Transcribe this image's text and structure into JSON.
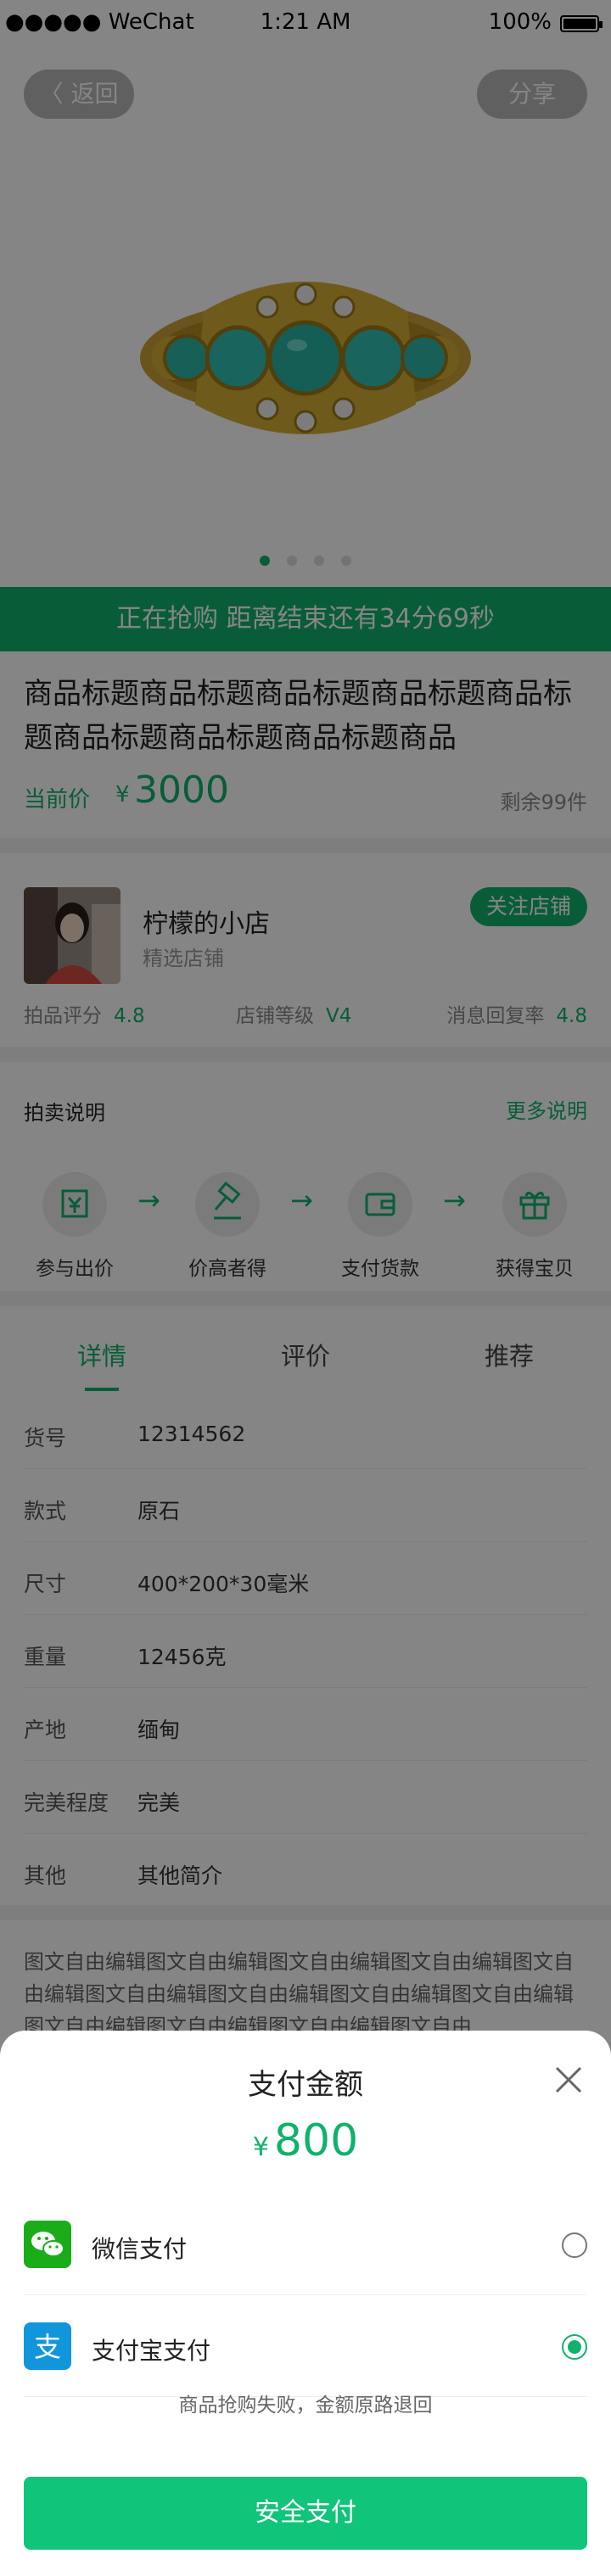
{
  "status_bar": {
    "carrier": "●●●●● WeChat",
    "time": "1:21 AM",
    "battery": "100%"
  },
  "header": {
    "back_label": "〈 返回",
    "share_label": "分享"
  },
  "countdown": {
    "text": "正在抢购   距离结束还有34分69秒"
  },
  "product": {
    "title": "商品标题商品标题商品标题商品标题商品标题商品标题商品标题商品标题商品",
    "price_label": "当前价",
    "price_symbol": "¥",
    "price": "3000",
    "stock": "剩余99件"
  },
  "shop": {
    "name": "柠檬的小店",
    "subtitle": "精选店铺",
    "follow_label": "关注店铺",
    "stats": [
      {
        "label": "拍品评分",
        "value": "4.8"
      },
      {
        "label": "店铺等级",
        "value": "V4"
      },
      {
        "label": "消息回复率",
        "value": "4.8"
      }
    ]
  },
  "auction": {
    "title": "拍卖说明",
    "more": "更多说明",
    "steps": [
      {
        "label": "参与出价",
        "icon": "yen-note-icon"
      },
      {
        "label": "价高者得",
        "icon": "gavel-icon"
      },
      {
        "label": "支付货款",
        "icon": "wallet-icon"
      },
      {
        "label": "获得宝贝",
        "icon": "gift-icon"
      }
    ],
    "arrow": "→"
  },
  "tabs": [
    {
      "label": "详情"
    },
    {
      "label": "评价"
    },
    {
      "label": "推荐"
    }
  ],
  "specs": [
    {
      "key": "货号",
      "value": "12314562"
    },
    {
      "key": "款式",
      "value": "原石"
    },
    {
      "key": "尺寸",
      "value": "400*200*30毫米"
    },
    {
      "key": "重量",
      "value": "12456克"
    },
    {
      "key": "产地",
      "value": "缅甸"
    },
    {
      "key": "完美程度",
      "value": "完美"
    },
    {
      "key": "其他",
      "value": "其他简介"
    }
  ],
  "rich_text": "图文自由编辑图文自由编辑图文自由编辑图文自由编辑图文自由编辑图文自由编辑图文自由编辑图文自由编辑图文自由编辑图文自由编辑图文自由编辑图文自由编辑图文自由",
  "payment": {
    "title": "支付金额",
    "symbol": "¥",
    "amount": "800",
    "options": [
      {
        "name": "微信支付",
        "selected": false,
        "color": "#1aad19"
      },
      {
        "name": "支付宝支付",
        "selected": true,
        "color": "#1296db"
      }
    ],
    "refund_note": "商品抢购失败，金额原路退回",
    "pay_label": "安全支付"
  },
  "colors": {
    "accent": "#10b26b",
    "pay_button": "#10c47a"
  }
}
